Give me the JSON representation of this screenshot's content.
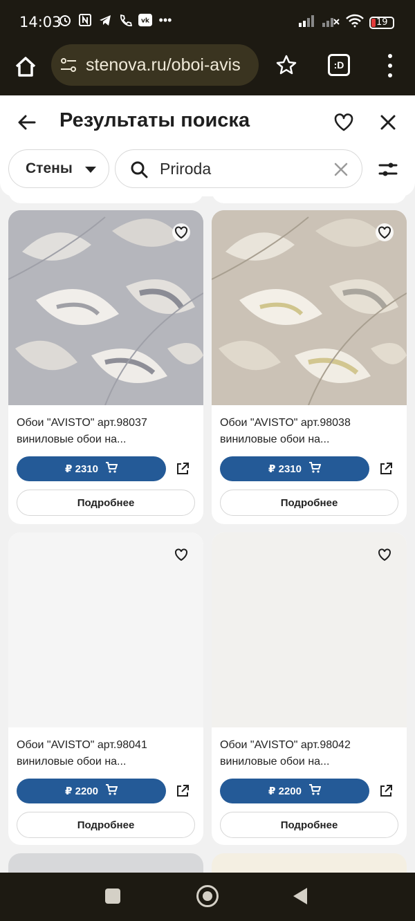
{
  "status_bar": {
    "time": "14:03",
    "battery": "19",
    "icons": [
      "alarm-icon",
      "nfc-icon",
      "telegram-icon",
      "wifi-call-icon",
      "vk-icon",
      "more-icon",
      "signal-icon",
      "signal-off-icon",
      "wifi-icon",
      "battery-icon"
    ]
  },
  "browser": {
    "url": "stenova.ru/oboi-avis",
    "tab_label": ":D"
  },
  "header": {
    "title": "Результаты поиска",
    "category": "Стены",
    "search_value": "Priroda"
  },
  "products": [
    {
      "name": "Обои \"AVISTO\" арт.98037",
      "desc": "виниловые обои на...",
      "price": "₽ 2310",
      "more": "Подробнее",
      "image": "grey-leaf-pattern",
      "bg": "#b5b6bc"
    },
    {
      "name": "Обои \"AVISTO\" арт.98038",
      "desc": "виниловые обои на...",
      "price": "₽ 2310",
      "more": "Подробнее",
      "image": "beige-leaf-pattern",
      "bg": "#cbc2b6"
    },
    {
      "name": "Обои \"AVISTO\" арт.98041",
      "desc": "виниловые обои на...",
      "price": "₽ 2200",
      "more": "Подробнее",
      "image": "plain-light",
      "bg": "#f5f5f5"
    },
    {
      "name": "Обои \"AVISTO\" арт.98042",
      "desc": "виниловые обои на...",
      "price": "₽ 2200",
      "more": "Подробнее",
      "image": "plain-warm",
      "bg": "#f2f1ee"
    }
  ],
  "colors": {
    "accent": "#245a97",
    "chrome": "#1d1a12",
    "page_bg": "#f1f1f1"
  }
}
